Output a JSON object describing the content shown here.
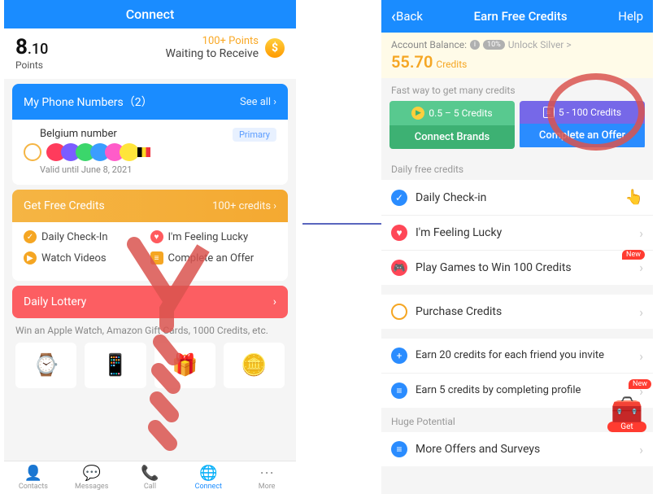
{
  "left": {
    "header": "Connect",
    "points_int": "8",
    "points_dec": ".10",
    "points_label": "Points",
    "waiting_points": "100+ Points",
    "waiting_text": "Waiting to Receive",
    "my_numbers_title": "My Phone Numbers（2）",
    "see_all": "See all",
    "belgium": "Belgium number",
    "valid": "Valid until June 8, 2021",
    "primary": "Primary",
    "get_credits": "Get Free Credits",
    "get_credits_count": "100+ credits",
    "cred1": "Daily Check-In",
    "cred2": "I'm Feeling Lucky",
    "cred3": "Watch Videos",
    "cred4": "Complete an Offer",
    "lottery": "Daily Lottery",
    "lottery_sub": "Win an Apple Watch, Amazon Gift Cards, 1000 Credits, etc.",
    "tabs": [
      "Contacts",
      "Messages",
      "Call",
      "Connect",
      "More"
    ]
  },
  "right": {
    "back": "Back",
    "title": "Earn Free Credits",
    "help": "Help",
    "acct_balance": "Account Balance:",
    "pct": "10%",
    "unlock": "Unlock Silver >",
    "balance": "55.70",
    "credits": "Credits",
    "fast": "Fast way to get many credits",
    "btn1_top": "0.5 – 5 Credits",
    "btn1_bot": "Connect Brands",
    "btn2_top": "5 - 100 Credits",
    "btn2_bot": "Complete an Offer",
    "daily_label": "Daily free credits",
    "item_checkin": "Daily Check-in",
    "item_lucky": "I'm Feeling Lucky",
    "item_games": "Play Games to Win 100 Credits",
    "item_purchase": "Purchase Credits",
    "item_invite": "Earn 20 credits for each friend you invite",
    "item_profile": "Earn 5 credits by completing profile",
    "huge": "Huge Potential",
    "item_more": "More Offers and Surveys",
    "new": "New",
    "get": "Get"
  }
}
